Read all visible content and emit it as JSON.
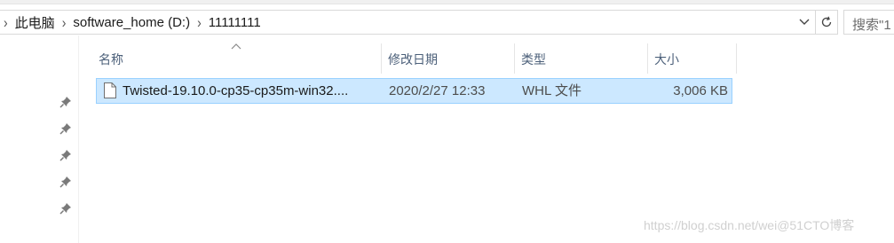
{
  "breadcrumb": {
    "items": [
      "此电脑",
      "software_home (D:)",
      "11111111"
    ]
  },
  "search": {
    "placeholder": "搜索\"1"
  },
  "columns": {
    "name": "名称",
    "modified": "修改日期",
    "type": "类型",
    "size": "大小"
  },
  "files": [
    {
      "name": "Twisted-19.10.0-cp35-cp35m-win32....",
      "modified": "2020/2/27 12:33",
      "type": "WHL 文件",
      "size": "3,006 KB"
    }
  ],
  "watermark": "https://blog.csdn.net/wei@51CTO博客",
  "colors": {
    "selection_bg": "#cce8ff",
    "selection_border": "#99d1ff",
    "header_text": "#4c607a"
  },
  "icons": [
    "chevron-right-icon",
    "chevron-down-icon",
    "refresh-icon",
    "pin-icon",
    "file-icon",
    "sort-up-icon"
  ]
}
